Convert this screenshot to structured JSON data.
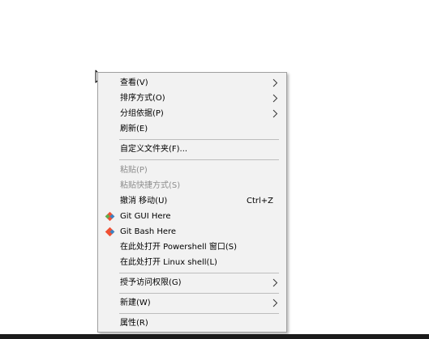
{
  "context_menu": {
    "view": "查看(V)",
    "sort_by": "排序方式(O)",
    "group_by": "分组依据(P)",
    "refresh": "刷新(E)",
    "customize_folder": "自定义文件夹(F)...",
    "paste": "粘贴(P)",
    "paste_shortcut": "粘贴快捷方式(S)",
    "undo_move": "撤消 移动(U)",
    "undo_move_shortcut": "Ctrl+Z",
    "git_gui": "Git GUI Here",
    "git_bash": "Git Bash Here",
    "open_powershell": "在此处打开 Powershell 窗口(S)",
    "open_linux_shell": "在此处打开 Linux shell(L)",
    "give_access": "授予访问权限(G)",
    "new": "新建(W)",
    "properties": "属性(R)"
  },
  "icons": {
    "cursor": "mouse-pointer-icon",
    "submenu": "chevron-right-icon",
    "git": "git-diamond-icon"
  },
  "colors": {
    "menu_background": "#f2f2f2",
    "menu_border": "#a0a0a0",
    "separator": "#bdbdbd",
    "disabled_text": "#8d8d8d",
    "git_orange": "#f05033",
    "git_blue": "#3b82c4",
    "taskbar": "#1b1b1b"
  }
}
